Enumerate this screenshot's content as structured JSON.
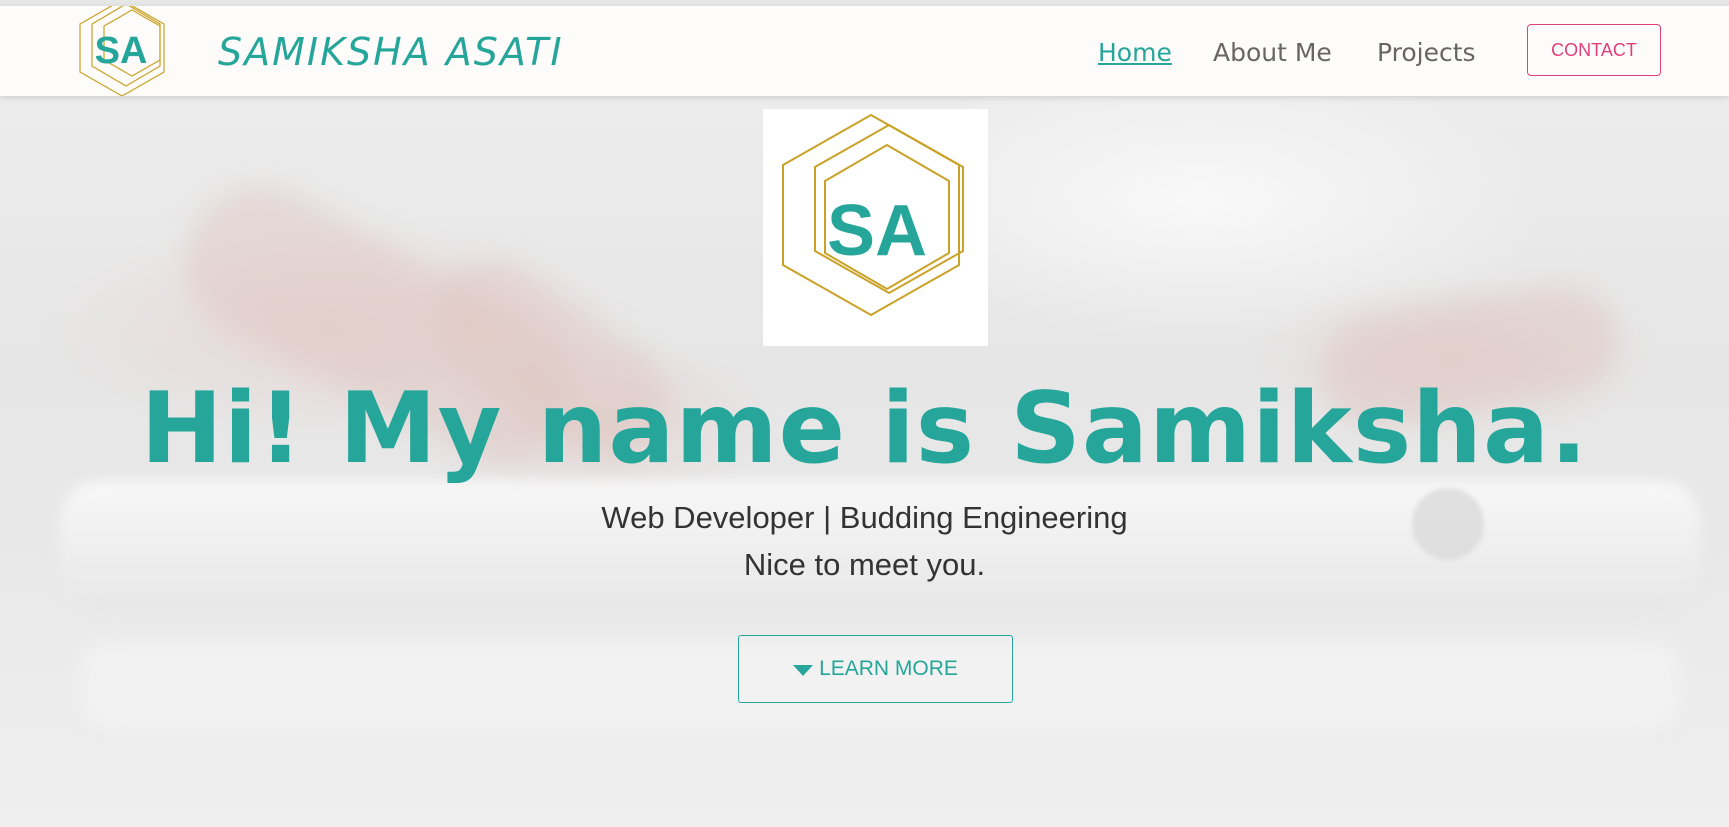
{
  "brand": {
    "logo_text": "SA",
    "name": "SAMIKSHA ASATI"
  },
  "nav": {
    "items": [
      {
        "label": "Home",
        "active": true
      },
      {
        "label": "About Me",
        "active": false
      },
      {
        "label": "Projects",
        "active": false
      }
    ],
    "contact_label": "CONTACT"
  },
  "hero": {
    "logo_text": "SA",
    "title": "Hi! My name is Samiksha.",
    "subtitle_line1": "Web Developer | Budding Engineering",
    "subtitle_line2": "Nice to meet you.",
    "cta_label": "LEARN MORE",
    "cta_icon": "caret-down-icon"
  },
  "colors": {
    "accent": "#26a69a",
    "contact": "#e0407a",
    "logo_gold": "#c9a227"
  }
}
